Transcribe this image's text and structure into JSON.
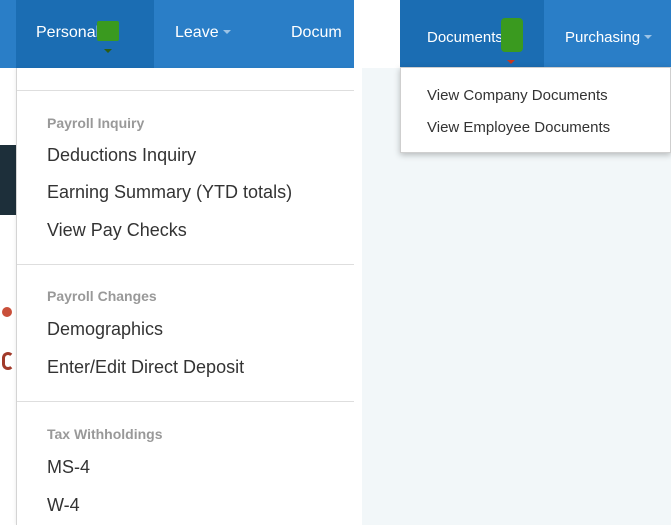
{
  "left_nav": {
    "tabs": [
      {
        "label": "Personal"
      },
      {
        "label": "Leave"
      },
      {
        "label": "Docum"
      }
    ]
  },
  "personal_menu": {
    "sections": [
      {
        "header": "Payroll Inquiry",
        "items": [
          "Deductions Inquiry",
          "Earning Summary (YTD totals)",
          "View Pay Checks"
        ]
      },
      {
        "header": "Payroll Changes",
        "items": [
          "Demographics",
          "Enter/Edit Direct Deposit"
        ]
      },
      {
        "header": "Tax Withholdings",
        "items": [
          "MS-4",
          "W-4"
        ]
      }
    ]
  },
  "right_nav": {
    "tabs": [
      {
        "label": "Documents"
      },
      {
        "label": "Purchasing"
      }
    ]
  },
  "documents_menu": {
    "items": [
      "View Company Documents",
      "View Employee Documents"
    ]
  },
  "colors": {
    "nav_blue": "#2a7ec7",
    "nav_active_blue": "#1b6db3",
    "highlight_green": "#3a9a1f"
  }
}
